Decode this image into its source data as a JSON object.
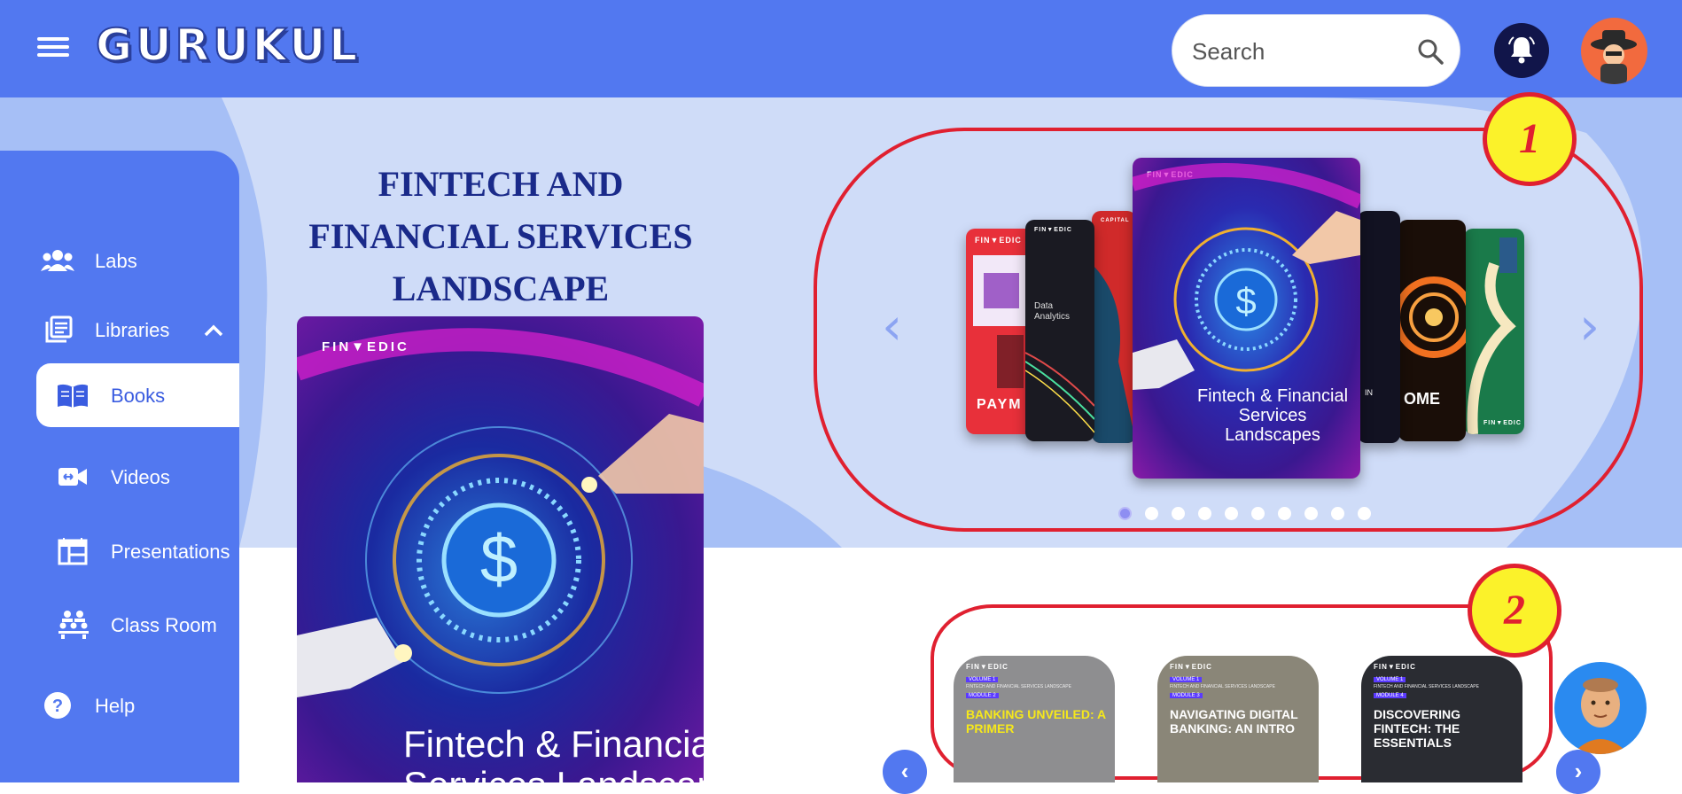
{
  "header": {
    "logo": "GURUKUL",
    "search_placeholder": "Search",
    "menu_icon": "hamburger-icon",
    "notification_icon": "bell-icon",
    "avatar_icon": "user-avatar"
  },
  "sidebar": {
    "items": [
      {
        "label": "Labs",
        "icon": "people-icon"
      },
      {
        "label": "Libraries",
        "icon": "library-icon",
        "expanded": true
      },
      {
        "label": "Books",
        "icon": "book-icon",
        "active": true
      },
      {
        "label": "Videos",
        "icon": "video-icon"
      },
      {
        "label": "Presentations",
        "icon": "presentation-icon"
      },
      {
        "label": "Class Room",
        "icon": "classroom-icon"
      },
      {
        "label": "Help",
        "icon": "help-icon"
      }
    ]
  },
  "featured": {
    "title_lines": [
      "FINTECH AND",
      "FINANCIAL SERVICES",
      "LANDSCAPE"
    ],
    "cover_brand": "FIN▼EDIC",
    "cover_title_lines": [
      "Fintech & Financial",
      "Services Landscapes"
    ]
  },
  "carousel": {
    "prev_arrow": "‹",
    "next_arrow": "›",
    "books": [
      {
        "brand": "FIN▼EDIC",
        "text": "PAYM",
        "color": "#e8303a"
      },
      {
        "brand": "FIN▼EDIC",
        "text": "Data Analytics",
        "color": "#1a1a22"
      },
      {
        "brand": "CAPITAL",
        "text": "",
        "color": "#d02a2a"
      },
      {
        "brand": "FIN▼EDIC",
        "text": "Fintech & Financial Services Landscapes",
        "color": "#4a1aa8"
      },
      {
        "brand": "",
        "text": "IN",
        "color": "#121222"
      },
      {
        "brand": "",
        "text": "OME",
        "color": "#1a0e08"
      },
      {
        "brand": "FIN▼EDIC",
        "text": "",
        "color": "#1a7a4a"
      }
    ],
    "dot_count": 10,
    "active_dot": 0
  },
  "annotations": {
    "badge_1": "1",
    "badge_2": "2"
  },
  "modules": [
    {
      "brand": "FIN▼EDIC",
      "volume": "VOLUME 1",
      "subtitle": "FINTECH AND FINANCIAL SERVICES LANDSCAPE",
      "module": "MODULE 2",
      "title": "BANKING UNVEILED: A PRIMER",
      "title_color": "#f6e81a",
      "bg": "#8e8e90"
    },
    {
      "brand": "FIN▼EDIC",
      "volume": "VOLUME 1",
      "subtitle": "FINTECH AND FINANCIAL SERVICES LANDSCAPE",
      "module": "MODULE 3",
      "title": "NAVIGATING DIGITAL BANKING: AN INTRO",
      "title_color": "#ffffff",
      "bg": "#8a8678"
    },
    {
      "brand": "FIN▼EDIC",
      "volume": "VOLUME 1",
      "subtitle": "FINTECH AND FINANCIAL SERVICES LANDSCAPE",
      "module": "MODULE 4",
      "title": "DISCOVERING FINTECH: THE ESSENTIALS",
      "title_color": "#ffffff",
      "bg": "#2a2c32"
    }
  ],
  "module_nav": {
    "prev": "‹",
    "next": "›"
  },
  "colors": {
    "primary": "#5278f0",
    "hero_bg": "#cfdcf8",
    "annotation_red": "#e02030",
    "badge_yellow": "#fbf22a"
  }
}
